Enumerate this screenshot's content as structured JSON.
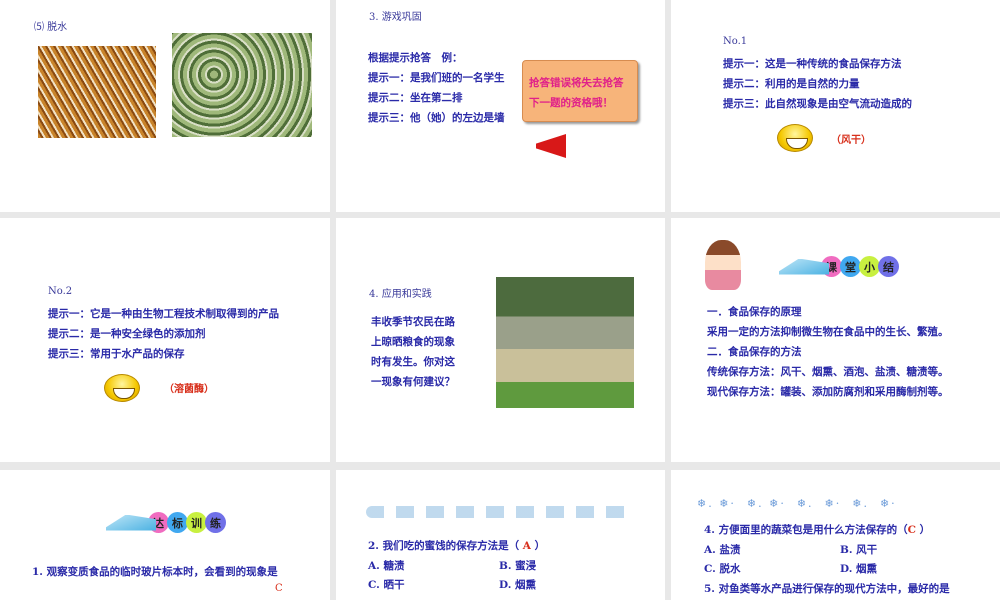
{
  "slides": [
    {
      "title": "⑸ 脱水"
    },
    {
      "title": "3. 游戏巩固",
      "lines": [
        "根据提示抢答　例：",
        "提示一：是我们班的一名学生",
        "提示二：坐在第二排",
        "提示三：他（她）的左边是墙"
      ],
      "callout": [
        "抢答错误将失去抢答",
        "下一题的资格哦！"
      ]
    },
    {
      "no": "No.1",
      "lines": [
        "提示一：这是一种传统的食品保存方法",
        "提示二：利用的是自然的力量",
        "提示三：此自然现象是由空气流动造成的"
      ],
      "answer": "（风干）"
    },
    {
      "no": "No.2",
      "lines": [
        "提示一：它是一种由生物工程技术制取得到的产品",
        "提示二：是一种安全绿色的添加剂",
        "提示三：常用于水产品的保存"
      ],
      "answer": "（溶菌酶）"
    },
    {
      "title": "4. 应用和实践",
      "lines": [
        "丰收季节农民在路",
        "上晾晒粮食的现象",
        "时有发生。你对这",
        "一现象有何建议？"
      ]
    },
    {
      "badge": [
        "课",
        "堂",
        "小",
        "结"
      ],
      "lines": [
        "一．食品保存的原理",
        "采用一定的方法抑制微生物在食品中的生长、繁殖。",
        "二．食品保存的方法",
        "传统保存方法：风干、烟熏、酒泡、盐渍、糖渍等。",
        "现代保存方法：罐装、添加防腐剂和采用酶制剂等。"
      ]
    },
    {
      "badge": [
        "达",
        "标",
        "训",
        "练"
      ],
      "question": "1. 观察变质食品的临时玻片标本时，会看到的现象是",
      "answer": "C"
    },
    {
      "question": "2. 我们吃的蜜饯的保存方法是（",
      "answer": "A",
      "close": "）",
      "options": [
        "A. 糖渍",
        "B. 蜜浸",
        "C. 晒干",
        "D. 烟熏"
      ]
    },
    {
      "question": "4. 方便面里的蔬菜包是用什么方法保存的（",
      "answer": "C",
      "close": "）",
      "options": [
        "A. 盐渍",
        "B. 风干",
        "C. 脱水",
        "D. 烟熏"
      ],
      "question2": "5. 对鱼类等水产品进行保存的现代方法中，最好的是"
    }
  ]
}
